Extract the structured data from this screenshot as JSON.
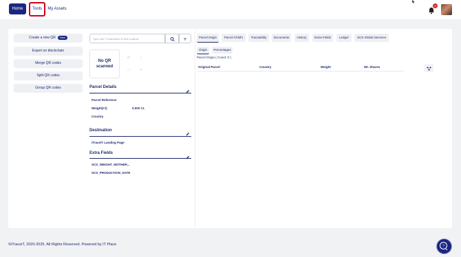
{
  "nav": {
    "home_label": "Home",
    "tools_label": "Tools",
    "assets_label": "My Assets",
    "notification_count": "9"
  },
  "sidebar": {
    "items": [
      {
        "label": "Create a new QR",
        "badge": "New"
      },
      {
        "label": "Export on blockchain"
      },
      {
        "label": "Merge QR codes"
      },
      {
        "label": "Split QR codes"
      },
      {
        "label": "Group QR codes"
      }
    ]
  },
  "search": {
    "placeholder": "Type min 3 characters to find a parcel"
  },
  "qr": {
    "status_text": "No QR scanned"
  },
  "parcel_details": {
    "title": "Parcel Details",
    "fields": [
      {
        "label": "Parcel Reference",
        "value": ""
      },
      {
        "label": "Weight(Ct)",
        "value": "0.000 Ct."
      },
      {
        "label": "Country",
        "value": ""
      }
    ]
  },
  "destination": {
    "title": "Destination",
    "fields": [
      {
        "label": "iTraceiT Landing Page"
      }
    ]
  },
  "extra_fields": {
    "title": "Extra Fields",
    "fields": [
      {
        "label": "SCS_WEIGHT_MOTHER..."
      },
      {
        "label": "SCS_PRODUCTION_DATE"
      }
    ]
  },
  "tabs": [
    "Parcel Origin",
    "Parcel Child's",
    "Traceability",
    "Documents",
    "History",
    "Extra Fields",
    "Ledger",
    "SCS Global Services"
  ],
  "subtabs": [
    "Origin",
    "Percentages"
  ],
  "origin": {
    "count_text": "Parcel Origin ( Count: 0 )",
    "columns": [
      "Original Parcel",
      "Country",
      "Weight",
      "Wt. Shares"
    ]
  },
  "footer": {
    "copyright": "©iTraceiT, 2020-2025. All Rights Reserved. Powered by",
    "brand": "IT Place"
  },
  "colors": {
    "primary": "#1b2680",
    "highlight_border": "#d0021b",
    "badge": "#e02424",
    "background": "#f1f2f4"
  }
}
